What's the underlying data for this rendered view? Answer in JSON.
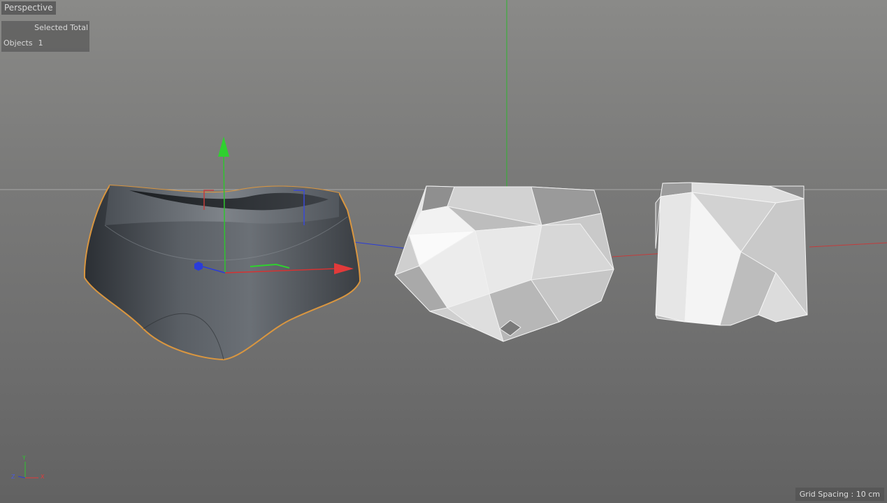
{
  "viewport": {
    "camera_label": "Perspective",
    "grid_spacing": "Grid Spacing : 10 cm"
  },
  "info_panel": {
    "header": "Selected Total",
    "rows": [
      {
        "label": "Objects",
        "value": "1"
      }
    ]
  },
  "axis_triad": {
    "y": "Y",
    "z": "Z",
    "x": "X"
  },
  "colors": {
    "x_axis": "#e23a3a",
    "y_axis": "#2fc42f",
    "z_axis": "#2a3cd8",
    "selection_outline": "#d99640"
  }
}
